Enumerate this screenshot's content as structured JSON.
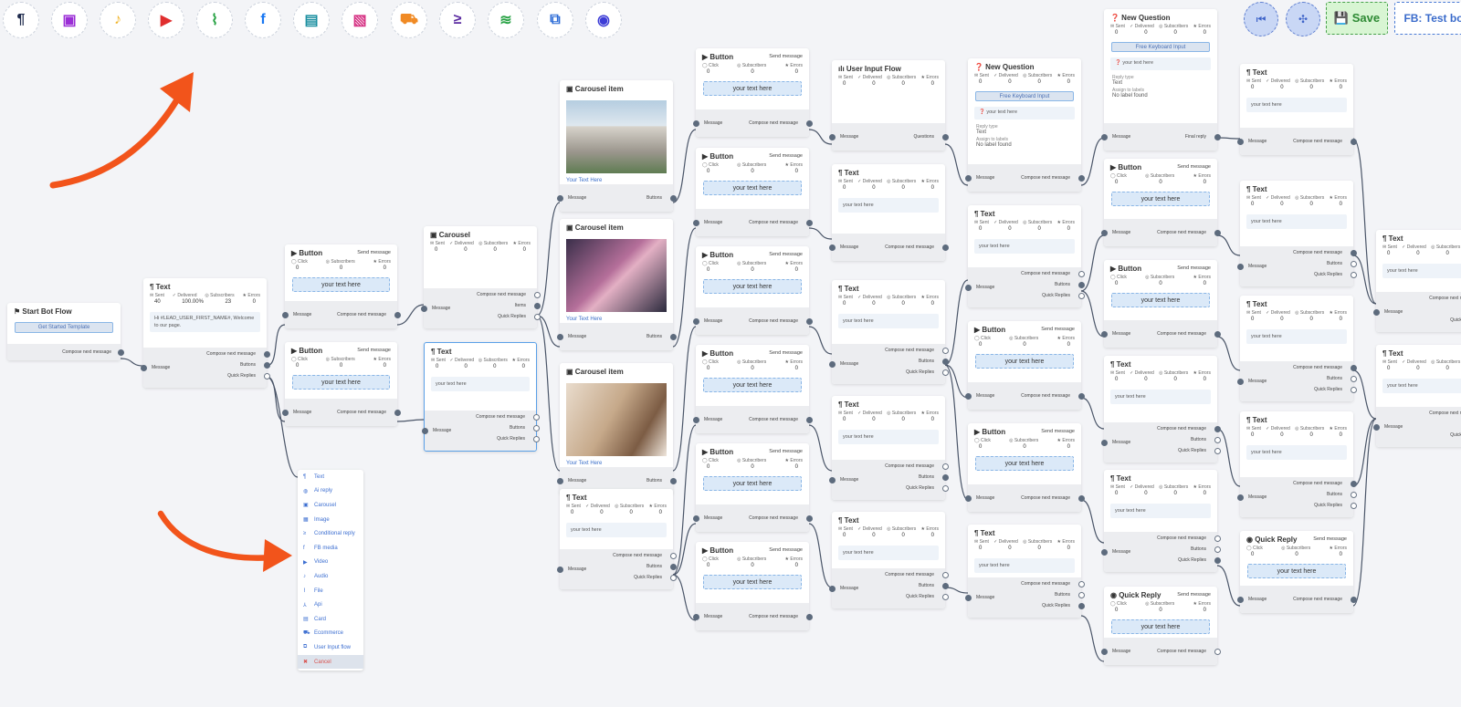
{
  "toolbar": [
    {
      "name": "text-tool-icon",
      "glyph": "¶",
      "color": "#1f2b4d"
    },
    {
      "name": "image-tool-icon",
      "glyph": "▣",
      "color": "#9b2fd6"
    },
    {
      "name": "audio-tool-icon",
      "glyph": "♪",
      "color": "#f0b429"
    },
    {
      "name": "video-tool-icon",
      "glyph": "▶",
      "color": "#e02e2e"
    },
    {
      "name": "file-tool-icon",
      "glyph": "⌇",
      "color": "#2aa346"
    },
    {
      "name": "facebook-tool-icon",
      "glyph": "f",
      "color": "#1877f2"
    },
    {
      "name": "card-tool-icon",
      "glyph": "▤",
      "color": "#1b8fa0"
    },
    {
      "name": "carousel-tool-icon",
      "glyph": "▧",
      "color": "#d63384"
    },
    {
      "name": "ecommerce-tool-icon",
      "glyph": "⛟",
      "color": "#f08a24"
    },
    {
      "name": "conditional-tool-icon",
      "glyph": "≥",
      "color": "#5a2aa0"
    },
    {
      "name": "ai-reply-tool-icon",
      "glyph": "≋",
      "color": "#2aa346"
    },
    {
      "name": "user-input-tool-icon",
      "glyph": "⧉",
      "color": "#2a6ad6"
    },
    {
      "name": "bot-tool-icon",
      "glyph": "◉",
      "color": "#3d3dd6"
    }
  ],
  "actions": {
    "first": "⏮",
    "center": "✣",
    "save": "💾 Save",
    "bot": "FB: Test bot"
  },
  "colors": {
    "accent": "#3d63c8",
    "edge": "#4a5568",
    "arrow": "#f2541b"
  },
  "labels": {
    "sent": "Sent",
    "delivered": "Delivered",
    "subscribers": "Subscribers",
    "errors": "Errors",
    "click": "Click",
    "send_message": "Send message",
    "compose": "Compose next message",
    "message": "Message",
    "buttons": "Buttons",
    "quick": "Quick Replies",
    "items": "Items",
    "questions": "Questions",
    "final": "Final reply",
    "text_here": "your text here",
    "Text_here": "Your Text Here",
    "free_kb": "Free Keyboard Input",
    "reply_type": "Reply type",
    "reply_val": "Text",
    "assign": "Assign to labels",
    "no_label": "No label found"
  },
  "start": {
    "title": "Start Bot Flow",
    "button": "Get Started Template"
  },
  "text_first": {
    "sent": "40",
    "delivered": "100.00%",
    "subscribers": "23",
    "errors": "0",
    "message": "Hi #LEAD_USER_FIRST_NAME#, Welcome to our page."
  },
  "titles": {
    "text": "Text",
    "button": "Button",
    "carousel": "Carousel",
    "carousel_item": "Carousel item",
    "user_input": "User Input Flow",
    "new_question": "New Question",
    "quick_reply": "Quick Reply"
  },
  "zero": "0",
  "menu": [
    {
      "icon": "¶",
      "label": "Text"
    },
    {
      "icon": "◍",
      "label": "Ai reply"
    },
    {
      "icon": "▣",
      "label": "Carousel"
    },
    {
      "icon": "▦",
      "label": "Image"
    },
    {
      "icon": "≥",
      "label": "Conditional reply"
    },
    {
      "icon": "f",
      "label": "FB media"
    },
    {
      "icon": "▶",
      "label": "Video"
    },
    {
      "icon": "♪",
      "label": "Audio"
    },
    {
      "icon": "⌇",
      "label": "File"
    },
    {
      "icon": "⅄",
      "label": "Api"
    },
    {
      "icon": "▤",
      "label": "Card"
    },
    {
      "icon": "⛟",
      "label": "Ecommerce"
    },
    {
      "icon": "⧉",
      "label": "User Input flow"
    },
    {
      "icon": "✖",
      "label": "Cancel"
    }
  ]
}
